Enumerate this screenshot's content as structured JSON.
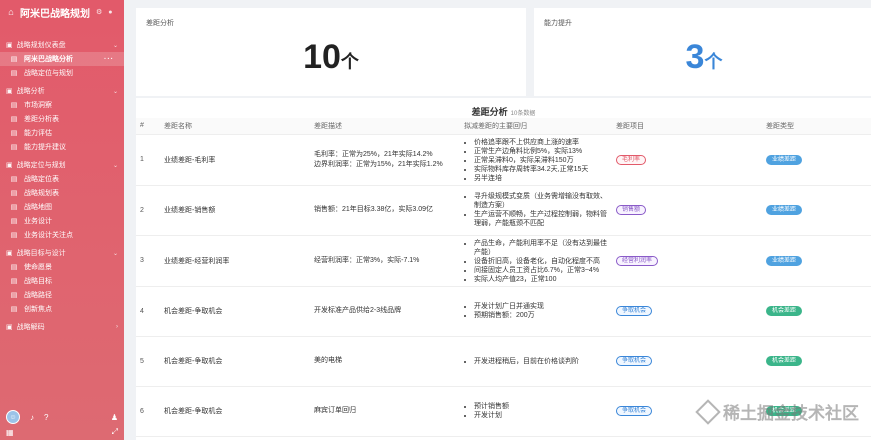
{
  "sidebar": {
    "title": "阿米巴战略规划",
    "groups": [
      {
        "label": "战略规划仪表盘",
        "items": [
          {
            "label": "阿米巴战略分析",
            "active": true
          },
          {
            "label": "战略定位与规划"
          }
        ]
      },
      {
        "label": "战略分析",
        "items": [
          {
            "label": "市场洞察"
          },
          {
            "label": "差距分析表"
          },
          {
            "label": "能力评估"
          },
          {
            "label": "能力提升建议"
          }
        ]
      },
      {
        "label": "战略定位与规划",
        "items": [
          {
            "label": "战略定位表"
          },
          {
            "label": "战略规划表"
          },
          {
            "label": "战略地图"
          },
          {
            "label": "业务设计"
          },
          {
            "label": "业务设计关注点"
          }
        ]
      },
      {
        "label": "战略目标与设计",
        "items": [
          {
            "label": "使命愿景"
          },
          {
            "label": "战略目标"
          },
          {
            "label": "战略路径"
          },
          {
            "label": "创新焦点"
          }
        ]
      },
      {
        "label": "战略解码",
        "items": []
      }
    ]
  },
  "cards": [
    {
      "title": "差距分析",
      "value": "10",
      "unit": "个"
    },
    {
      "title": "能力提升",
      "value": "3",
      "unit": "个"
    }
  ],
  "table": {
    "title": "差距分析",
    "subtitle": "10条数据",
    "headers": [
      "#",
      "差距名称",
      "差距描述",
      "拟减差距的主要回归",
      "差距项目",
      "差距类型"
    ],
    "rows": [
      {
        "idx": "1",
        "name": "业绩差距-毛利率",
        "desc": [
          "毛利率：正常为25%，21年实际14.2%",
          "边界利润率：正常为15%，21年实际1.2%"
        ],
        "reasons": [
          "价格追率跟不上供应商上涨的速率",
          "正常生产边角料比例5%，实际13%",
          "正常呆滞料0，实际呆滞料150万",
          "实际物料库存周转率34.2天,正常15天",
          "另半连培"
        ],
        "tag": "毛利率",
        "tagc": "red",
        "type": "业绩差距",
        "typec": "b"
      },
      {
        "idx": "2",
        "name": "业绩差距-销售额",
        "desc": [
          "销售额：21年目标3.38亿，实际3.09亿"
        ],
        "reasons": [
          "寻升级规模式变质（业务需增输没有取效、制造方案）",
          "生产运营不顺畅，生产过程控制弱，物料管理弱，产能瓶颈不匹配"
        ],
        "tag": "销售额",
        "tagc": "purple",
        "type": "业绩差距",
        "typec": "b"
      },
      {
        "idx": "3",
        "name": "业绩差距-经营利润率",
        "desc": [
          "经营利润率：正常3%，实际-7.1%"
        ],
        "reasons": [
          "产品生命，产能利用率不足（没有达到最佳产能）",
          "设备折旧高，设备老化，自动化程度不高",
          "间接固定人员工资占比6.7%，正常3~4%",
          "实际人均产值23，正常100"
        ],
        "tag": "经营利润率",
        "tagc": "purple",
        "type": "业绩差距",
        "typec": "b"
      },
      {
        "idx": "4",
        "name": "机会差距-争取机会",
        "desc": [
          "开发标准产品供给2-3线品牌"
        ],
        "reasons": [
          "开发计划广日并通实现",
          "预期销售额：200万"
        ],
        "tag": "争取机会",
        "tagc": "blue",
        "type": "机会差距",
        "typec": "g"
      },
      {
        "idx": "5",
        "name": "机会差距-争取机会",
        "desc": [
          "美的电梯"
        ],
        "reasons": [
          "开发进程稍后，目前在价格谈判阶"
        ],
        "tag": "争取机会",
        "tagc": "blue",
        "type": "机会差距",
        "typec": "g"
      },
      {
        "idx": "6",
        "name": "机会差距-争取机会",
        "desc": [
          "麻宾订单回归"
        ],
        "reasons": [
          "预计销售额",
          "开发计划"
        ],
        "tag": "争取机会",
        "tagc": "blue",
        "type": "机会差距",
        "typec": "g"
      }
    ]
  },
  "watermark": "稀土掘金技术社区"
}
